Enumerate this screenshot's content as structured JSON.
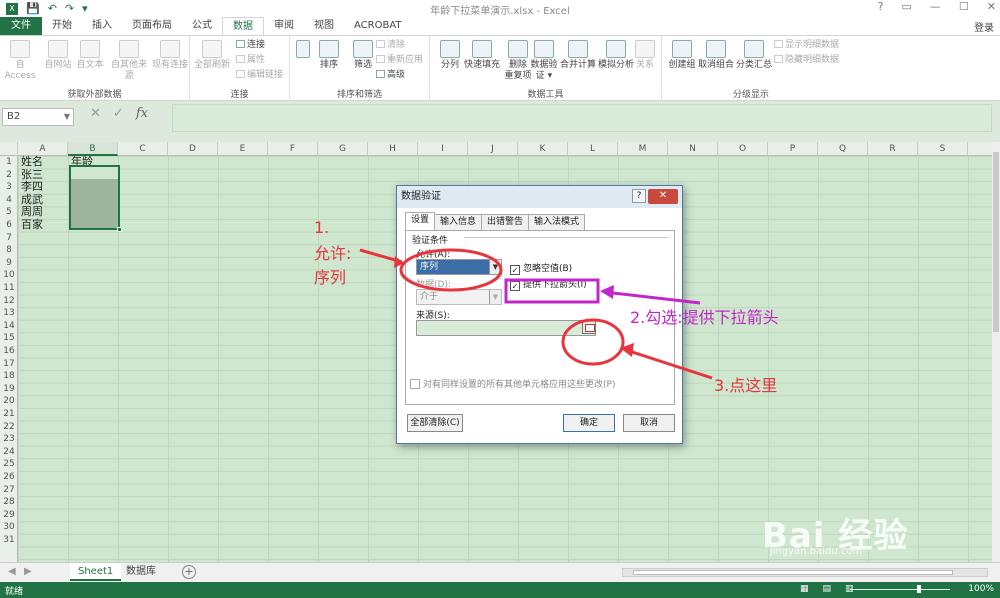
{
  "window": {
    "title": "年龄下拉菜单演示.xlsx - Excel",
    "controls": [
      "?",
      "▭",
      "—",
      "☐",
      "✕"
    ]
  },
  "tabs": [
    "文件",
    "开始",
    "插入",
    "页面布局",
    "公式",
    "数据",
    "审阅",
    "视图",
    "ACROBAT"
  ],
  "account": "登录",
  "ribbon": {
    "groups": {
      "external": "获取外部数据",
      "connections": "连接",
      "sort_filter": "排序和筛选",
      "data_tools": "数据工具",
      "outline": "分级显示"
    },
    "buttons": {
      "access": "自 Access",
      "web": "自网站",
      "text": "自文本",
      "other": "自其他来源",
      "existing": "现有连接",
      "refresh_all": "全部刷新",
      "connections": "连接",
      "properties": "属性",
      "edit_links": "编辑链接",
      "sort_az": "A↓Z",
      "sort": "排序",
      "filter": "筛选",
      "clear": "清除",
      "reapply": "重新应用",
      "advanced": "高级",
      "text_to_columns": "分列",
      "flash_fill": "快速填充",
      "remove_dup": "删除\n重复项",
      "validation": "数据验\n证 ▾",
      "consolidate": "合并计算",
      "what_if": "模拟分析",
      "relationships": "关系",
      "group": "创建组",
      "ungroup": "取消组合",
      "subtotal": "分类汇总",
      "show_detail": "显示明细数据",
      "hide_detail": "隐藏明细数据"
    }
  },
  "formula_bar": {
    "name_box": "B2",
    "icons": [
      "✕",
      "✓",
      "fx"
    ]
  },
  "sheet": {
    "columns": [
      "A",
      "B",
      "C",
      "D",
      "E",
      "F",
      "G",
      "H",
      "I",
      "J",
      "K",
      "L",
      "M",
      "N",
      "O",
      "P",
      "Q",
      "R",
      "S"
    ],
    "selected_column": "B",
    "row_count": 31,
    "cells": [
      {
        "ref": "A1",
        "text": "姓名"
      },
      {
        "ref": "B1",
        "text": "年龄"
      },
      {
        "ref": "A2",
        "text": "张三"
      },
      {
        "ref": "A3",
        "text": "李四"
      },
      {
        "ref": "A4",
        "text": "成武"
      },
      {
        "ref": "A5",
        "text": "周周"
      },
      {
        "ref": "A6",
        "text": "百家"
      }
    ],
    "tabs": [
      "Sheet1",
      "数据库"
    ],
    "active_tab": "Sheet1"
  },
  "status": {
    "ready": "就绪",
    "zoom": "100%"
  },
  "dialog": {
    "title": "数据验证",
    "tabs": [
      "设置",
      "输入信息",
      "出错警告",
      "输入法模式"
    ],
    "active_tab": "设置",
    "criteria_label": "验证条件",
    "allow_label": "允许(A):",
    "allow_value": "序列",
    "data_label": "数据(D):",
    "data_value": "介于",
    "ignore_blank": "忽略空值(B)",
    "ignore_blank_checked": true,
    "dropdown": "提供下拉箭头(I)",
    "dropdown_checked": true,
    "source_label": "来源(S):",
    "source_value": "",
    "apply_all": "对有同样设置的所有其他单元格应用这些更改(P)",
    "apply_all_checked": false,
    "clear_all": "全部清除(C)",
    "ok": "确定",
    "cancel": "取消"
  },
  "annotations": {
    "step1_num": "1.",
    "step1_line1": "允许:",
    "step1_line2": "序列",
    "step2": "2.勾选:提供下拉箭头",
    "step3": "3.点这里",
    "colors": {
      "red": "#e8343d",
      "purple": "#c026c8"
    }
  },
  "watermark": {
    "brand": "Bai 经验",
    "url": "jingyan.baidu.com"
  }
}
